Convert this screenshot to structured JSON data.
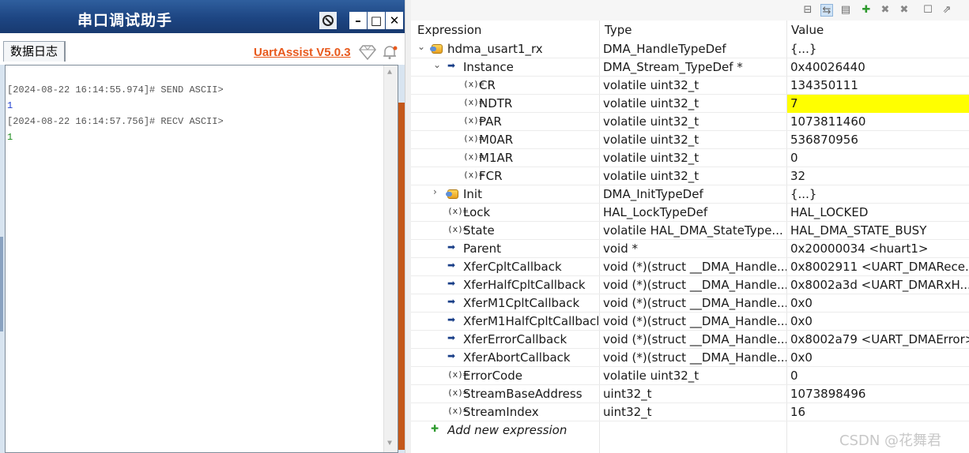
{
  "uart": {
    "title": "串口调试助手",
    "tab_log": "数据日志",
    "brand": "UartAssist V5.0.3",
    "minimize_glyph": "–",
    "maximize_glyph": "□",
    "close_glyph": "✕",
    "log": [
      {
        "text": "[2024-08-22 16:14:55.974]# SEND ASCII>",
        "color": "#555555"
      },
      {
        "text": "1",
        "color": "#1f3fd0"
      },
      {
        "text": "[2024-08-22 16:14:57.756]# RECV ASCII>",
        "color": "#555555"
      },
      {
        "text": "1",
        "color": "#1a8a1a"
      }
    ]
  },
  "expressions": {
    "headers": {
      "expression": "Expression",
      "type": "Type",
      "value": "Value"
    },
    "rows": [
      {
        "name": "hdma_usart1_rx",
        "type": "DMA_HandleTypeDef",
        "value": "{...}",
        "icon": "struct",
        "expander": "open"
      },
      {
        "name": "Instance",
        "type": "DMA_Stream_TypeDef *",
        "value": "0x40026440",
        "icon": "pointer",
        "expander": "open"
      },
      {
        "name": "CR",
        "type": "volatile uint32_t",
        "value": "134350111",
        "icon": "variable"
      },
      {
        "name": "NDTR",
        "type": "volatile uint32_t",
        "value": "7",
        "icon": "variable",
        "highlight": true
      },
      {
        "name": "PAR",
        "type": "volatile uint32_t",
        "value": "1073811460",
        "icon": "variable"
      },
      {
        "name": "M0AR",
        "type": "volatile uint32_t",
        "value": "536870956",
        "icon": "variable"
      },
      {
        "name": "M1AR",
        "type": "volatile uint32_t",
        "value": "0",
        "icon": "variable"
      },
      {
        "name": "FCR",
        "type": "volatile uint32_t",
        "value": "32",
        "icon": "variable"
      },
      {
        "name": "Init",
        "type": "DMA_InitTypeDef",
        "value": "{...}",
        "icon": "struct",
        "expander": "closed"
      },
      {
        "name": "Lock",
        "type": "HAL_LockTypeDef",
        "value": "HAL_LOCKED",
        "icon": "variable"
      },
      {
        "name": "State",
        "type": "volatile HAL_DMA_StateType...",
        "value": "HAL_DMA_STATE_BUSY",
        "icon": "variable"
      },
      {
        "name": "Parent",
        "type": "void *",
        "value": "0x20000034 <huart1>",
        "icon": "pointer"
      },
      {
        "name": "XferCpltCallback",
        "type": "void (*)(struct __DMA_Handle...",
        "value": "0x8002911 <UART_DMARece...",
        "icon": "pointer"
      },
      {
        "name": "XferHalfCpltCallback",
        "type": "void (*)(struct __DMA_Handle...",
        "value": "0x8002a3d <UART_DMARxH...",
        "icon": "pointer"
      },
      {
        "name": "XferM1CpltCallback",
        "type": "void (*)(struct __DMA_Handle...",
        "value": "0x0",
        "icon": "pointer"
      },
      {
        "name": "XferM1HalfCpltCallback",
        "type": "void (*)(struct __DMA_Handle...",
        "value": "0x0",
        "icon": "pointer"
      },
      {
        "name": "XferErrorCallback",
        "type": "void (*)(struct __DMA_Handle...",
        "value": "0x8002a79 <UART_DMAError>",
        "icon": "pointer"
      },
      {
        "name": "XferAbortCallback",
        "type": "void (*)(struct __DMA_Handle...",
        "value": "0x0",
        "icon": "pointer"
      },
      {
        "name": "ErrorCode",
        "type": "volatile uint32_t",
        "value": "0",
        "icon": "variable"
      },
      {
        "name": "StreamBaseAddress",
        "type": "uint32_t",
        "value": "1073898496",
        "icon": "variable"
      },
      {
        "name": "StreamIndex",
        "type": "uint32_t",
        "value": "16",
        "icon": "variable"
      }
    ],
    "add_new": "Add new expression",
    "highlight_color": "#ffff00"
  },
  "watermark": "CSDN @花舞君"
}
